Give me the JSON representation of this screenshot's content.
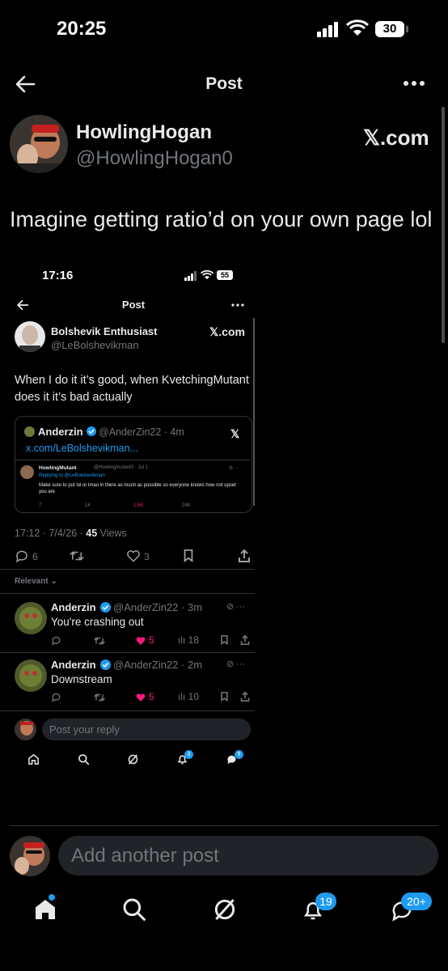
{
  "status_bar": {
    "time": "20:25",
    "battery": "30"
  },
  "header": {
    "title": "Post"
  },
  "post": {
    "author_name": "HowlingHogan",
    "author_handle": "@HowlingHogan0",
    "source_label": "𝕏.com",
    "text": "Imagine getting ratio’d on your own page lol"
  },
  "embedded": {
    "status_time": "17:16",
    "battery": "55",
    "title": "Post",
    "author_name": "Bolshevik Enthusiast",
    "author_handle": "@LeBolshevikman",
    "source_label": "𝕏.com",
    "text": "When I do it it’s good, when KvetchingMutant does it it’s bad actually",
    "quote": {
      "name": "Anderzin",
      "handle_time": "@AnderZin22 · 4m",
      "link": "x.com/LeBolshevikman...",
      "inner_name": "HowlingMutant",
      "inner_meta": "@Howlingmutant0 · Jul 1",
      "inner_reply": "Replying to @LeBolshevikman",
      "inner_text": "Make sure to put lol or lmao in there as much as possible so everyone knows how not upset you are",
      "inner_stats": [
        "7",
        "14",
        "1.5K",
        "24K"
      ]
    },
    "meta_time": "17:12 · 7/4/26 · ",
    "meta_views_count": "45",
    "meta_views_label": " Views",
    "stats": {
      "replies": "6",
      "likes": "3"
    },
    "relevant_label": "Relevant",
    "replies": [
      {
        "name": "Anderzin",
        "handle_time": "@AnderZin22 · 3m",
        "text": "You're crashing out",
        "likes": "5",
        "views": "18"
      },
      {
        "name": "Anderzin",
        "handle_time": "@AnderZin22 · 2m",
        "text": "Downstream",
        "likes": "5",
        "views": "10"
      }
    ],
    "reply_placeholder": "Post your reply",
    "nav_badges": {
      "notifications": "3",
      "messages": "9"
    }
  },
  "composer": {
    "placeholder": "Add another post"
  },
  "bottom_nav": {
    "notifications_badge": "19",
    "messages_badge": "20+"
  },
  "colors": {
    "background": "#000000",
    "accent": "#1d9bf0",
    "like": "#f91880",
    "muted": "#71767b"
  }
}
